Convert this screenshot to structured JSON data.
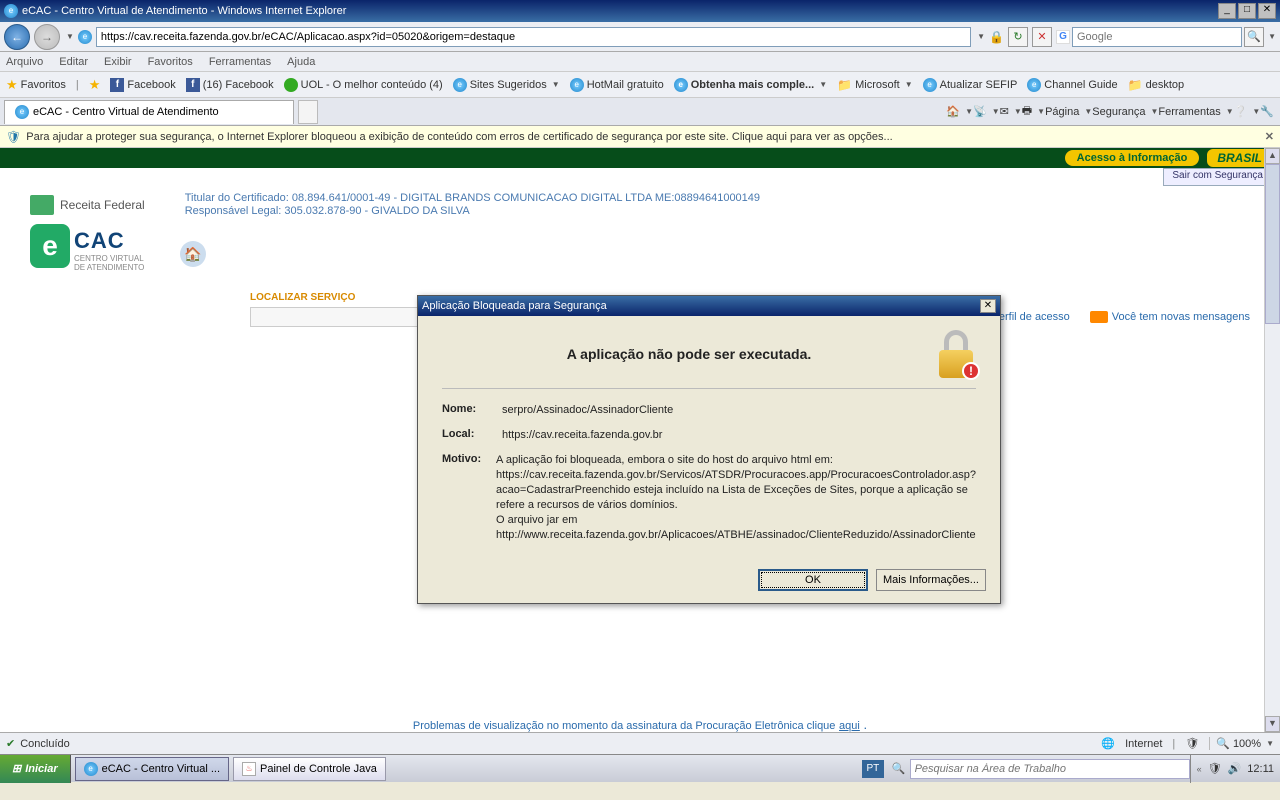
{
  "window": {
    "title": "eCAC - Centro Virtual de Atendimento - Windows Internet Explorer",
    "min": "_",
    "max": "□",
    "close": "✕"
  },
  "nav": {
    "url": "https://cav.receita.fazenda.gov.br/eCAC/Aplicacao.aspx?id=05020&origem=destaque",
    "search_placeholder": "Google",
    "refresh": "↻",
    "stop": "✕"
  },
  "menu": {
    "arquivo": "Arquivo",
    "editar": "Editar",
    "exibir": "Exibir",
    "favoritos": "Favoritos",
    "ferramentas": "Ferramentas",
    "ajuda": "Ajuda"
  },
  "favbar": {
    "favoritos": "Favoritos",
    "items": [
      {
        "label": "Facebook"
      },
      {
        "label": "(16) Facebook"
      },
      {
        "label": "UOL - O melhor conteúdo (4)"
      },
      {
        "label": "Sites Sugeridos"
      },
      {
        "label": "HotMail gratuito"
      },
      {
        "label": "Obtenha mais comple..."
      },
      {
        "label": "Microsoft"
      },
      {
        "label": "Atualizar SEFIP"
      },
      {
        "label": "Channel Guide"
      },
      {
        "label": "desktop"
      }
    ]
  },
  "tab": {
    "label": "eCAC - Centro Virtual de Atendimento"
  },
  "cmd": {
    "pagina": "Página",
    "seguranca": "Segurança",
    "ferramentas": "Ferramentas"
  },
  "infobar": {
    "msg": "Para ajudar a proteger sua segurança, o Internet Explorer bloqueou a exibição de conteúdo com erros de certificado de segurança por este site. Clique aqui para ver as opções..."
  },
  "page": {
    "acesso": "Acesso à Informação",
    "brasil": "BRASIL",
    "sair": "Sair com Segurança",
    "rf": "Receita Federal",
    "cert1": "Titular do Certificado: 08.894.641/0001-49 - DIGITAL BRANDS COMUNICACAO DIGITAL LTDA ME:08894641000149",
    "cert2": "Responsável Legal: 305.032.878-90 - GIVALDO DA SILVA",
    "cac": "CAC",
    "sub1": "CENTRO VIRTUAL",
    "sub2": "DE ATENDIMENTO",
    "localizar": "LOCALIZAR SERVIÇO",
    "alterar": "Alterar perfil de acesso",
    "novas": "Você tem novas mensagens",
    "foot": "Problemas de visualização no momento da assinatura da Procuração Eletrônica clique",
    "aqui": "aqui"
  },
  "dialog": {
    "title": "Aplicação Bloqueada para Segurança",
    "heading": "A aplicação não pode ser executada.",
    "nome_lbl": "Nome:",
    "nome_val": "serpro/Assinadoc/AssinadorCliente",
    "local_lbl": "Local:",
    "local_val": "https://cav.receita.fazenda.gov.br",
    "motivo_lbl": "Motivo:",
    "motivo_val": "A aplicação foi bloqueada, embora o site do host do arquivo html em: https://cav.receita.fazenda.gov.br/Servicos/ATSDR/Procuracoes.app/ProcuracoesControlador.asp?acao=CadastrarPreenchido esteja incluído na Lista de Exceções de Sites, porque a aplicação se refere a recursos de vários domínios.\nO arquivo jar em http://www.receita.fazenda.gov.br/Aplicacoes/ATBHE/assinadoc/ClienteReduzido/AssinadorCliente",
    "ok": "OK",
    "mais": "Mais Informações..."
  },
  "status": {
    "left": "Concluído",
    "zone": "Internet",
    "zoom": "100%"
  },
  "taskbar": {
    "start": "Iniciar",
    "task1": "eCAC - Centro Virtual ...",
    "task2": "Painel de Controle Java",
    "lang": "PT",
    "search": "Pesquisar na Área de Trabalho",
    "clock": "12:11"
  }
}
